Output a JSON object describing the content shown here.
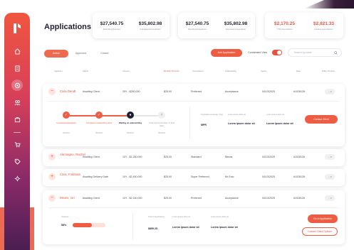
{
  "page": {
    "title": "Applications"
  },
  "colors": {
    "accent": "#ee5d43",
    "accent_text": "#e8533f"
  },
  "stats": {
    "card1": [
      {
        "value": "$27,540.75",
        "label": "Submitted Premium"
      },
      {
        "value": "$35,802.98",
        "label": "Calculated Commission"
      }
    ],
    "card2": [
      {
        "value": "$27,540.75",
        "label": "Pending Acceptance"
      },
      {
        "value": "$35,802.98",
        "label": "Approved Commission"
      }
    ],
    "card3": [
      {
        "value": "$2,170.25",
        "label": "YTD Commission"
      },
      {
        "value": "$2,821.33",
        "label": "Lifetime Commission"
      }
    ]
  },
  "toolbar": {
    "tabs": [
      "Active",
      "Approved",
      "Closed"
    ],
    "add_label": "Add Application",
    "condensed_label": "Condensed View",
    "search_placeholder": "Search by name"
  },
  "table": {
    "headers": [
      "Applicant",
      "Status",
      "Amount",
      "Monthly Premium",
      "Commission",
      "Underwriting",
      "Carrier",
      "Date",
      "Policy Number",
      "Actions"
    ],
    "rows": [
      {
        "name": "Cara Dendt",
        "status": "Awaiting Client",
        "amount": "25Y - $250,000",
        "premium": "$25.00",
        "class": "Preferred",
        "carrier": "Acceptance",
        "date": "04/13/2025",
        "policy": "#1028126",
        "action": "⋮ ▾"
      },
      {
        "name": "Alemagne, Rachel",
        "status": "Awaiting Client",
        "amount": "10Y - $1,250,000",
        "premium": "$25.00",
        "class": "Standard",
        "carrier": "Banda",
        "date": "04/13/2025",
        "policy": "#1028126",
        "action": "⋮ ▾"
      },
      {
        "name": "Cara, Foldman",
        "status": "Awaiting Delivery Date",
        "amount": "10Y - $2,450,000",
        "premium": "$25.00",
        "class": "Super Preferred",
        "carrier": "Mr Enio",
        "date": "04/13/2025",
        "policy": "#1028126",
        "action": "⋮ ▾"
      },
      {
        "name": "Mears, Iori",
        "status": "Awaiting Client",
        "amount": "10Y - $2,150,000",
        "premium": "$25.00",
        "class": "Preferred",
        "carrier": "Acceptance",
        "date": "04/13/2025",
        "policy": "#1028126",
        "action": "⋮ ▾"
      }
    ]
  },
  "expanded": {
    "steps": [
      {
        "label": "Completed application",
        "date": "05/12/21",
        "icon": "check"
      },
      {
        "label": "Completed underwriting docs",
        "date": "05/12/21",
        "icon": "check"
      },
      {
        "label": "Waiting on underwriting",
        "date": "05/12/21",
        "icon": "clock"
      },
      {
        "label": "Underwriting decision of final state",
        "date": "05/12/21",
        "icon": "x"
      }
    ],
    "meta": [
      {
        "label": "Application Coverage Type",
        "value": "MPR"
      },
      {
        "label": "Lorem ipsum dolor sit",
        "value": "Lorem ipsum dolor sit"
      },
      {
        "label": "Lorem ipsum dolor sit",
        "value": "Lorem ipsum dolor sit"
      }
    ],
    "button": "Contact Client"
  },
  "expanded2": {
    "progress_label": "Progress",
    "progress_value": "58%",
    "progress_fraction": 0.58,
    "meta": [
      {
        "label": "Total of Applications",
        "value": "$859.25"
      },
      {
        "label": "Lorem ipsum dolor sit",
        "value": "Lorem ipsum dolor sit"
      },
      {
        "label": "Lorem ipsum dolor sit",
        "value": "Lorem ipsum dolor sit"
      }
    ],
    "primary_button": "Go to Application",
    "secondary_button": "Contact Client Options"
  }
}
